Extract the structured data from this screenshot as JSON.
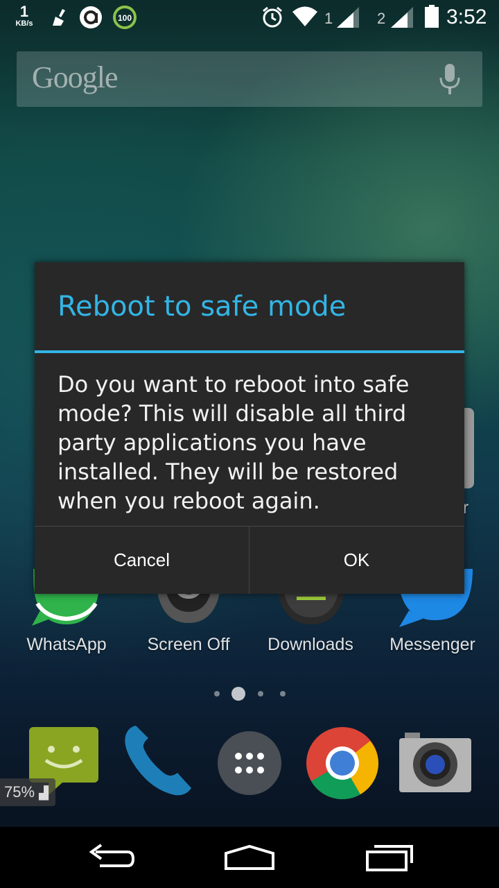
{
  "status_bar": {
    "net_speed_value": "1",
    "net_speed_unit": "KB/s",
    "booster_badge": "100",
    "sim1_label": "1",
    "sim2_label": "2",
    "time": "3:52"
  },
  "search_bar": {
    "logo_text": "Google"
  },
  "dialog": {
    "title": "Reboot to safe mode",
    "message": "Do you want to reboot into safe mode? This will disable all third party applications you have installed. They will be restored when you reboot again.",
    "cancel_label": "Cancel",
    "ok_label": "OK"
  },
  "home_apps": [
    {
      "label": "WhatsApp"
    },
    {
      "label": "Screen Off"
    },
    {
      "label": "Downloads"
    },
    {
      "label": "Messenger"
    }
  ],
  "partial_label": "ger",
  "dock": {
    "battery_percent": "75%"
  },
  "colors": {
    "accent": "#33b5e5",
    "dialog_bg": "#282828"
  }
}
